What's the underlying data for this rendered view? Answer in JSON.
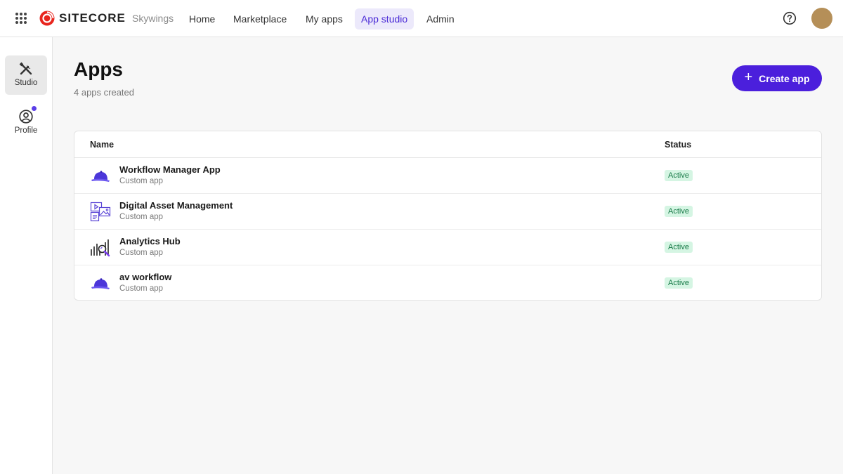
{
  "topbar": {
    "logo_text": "SITECORE",
    "org_name": "Skywings",
    "nav": [
      {
        "label": "Home",
        "active": false
      },
      {
        "label": "Marketplace",
        "active": false
      },
      {
        "label": "My apps",
        "active": false
      },
      {
        "label": "App studio",
        "active": true
      },
      {
        "label": "Admin",
        "active": false
      }
    ],
    "icons": {
      "menu": "grid-menu-icon",
      "help": "help-circle-icon",
      "avatar": "user-avatar"
    },
    "colors": {
      "brand_red": "#e8261e",
      "accent": "#4b1fdc",
      "avatar": "#b58f58"
    }
  },
  "sidebar": {
    "items": [
      {
        "label": "Studio",
        "icon": "tools-icon",
        "active": true
      },
      {
        "label": "Profile",
        "icon": "user-circle-icon",
        "active": false,
        "notification": true
      }
    ]
  },
  "main": {
    "title": "Apps",
    "subtitle": "4 apps created",
    "create_button": "Create app",
    "table": {
      "columns": [
        "Name",
        "Status"
      ],
      "rows": [
        {
          "name": "Workflow Manager App",
          "type": "Custom app",
          "status": "Active",
          "icon": "cap-icon"
        },
        {
          "name": "Digital Asset Management",
          "type": "Custom app",
          "status": "Active",
          "icon": "media-assets-icon"
        },
        {
          "name": "Analytics Hub",
          "type": "Custom app",
          "status": "Active",
          "icon": "analytics-search-icon"
        },
        {
          "name": "av workflow",
          "type": "Custom app",
          "status": "Active",
          "icon": "cap-icon"
        }
      ]
    },
    "colors": {
      "status_bg": "#d5f5e3",
      "status_text": "#177a47"
    }
  }
}
